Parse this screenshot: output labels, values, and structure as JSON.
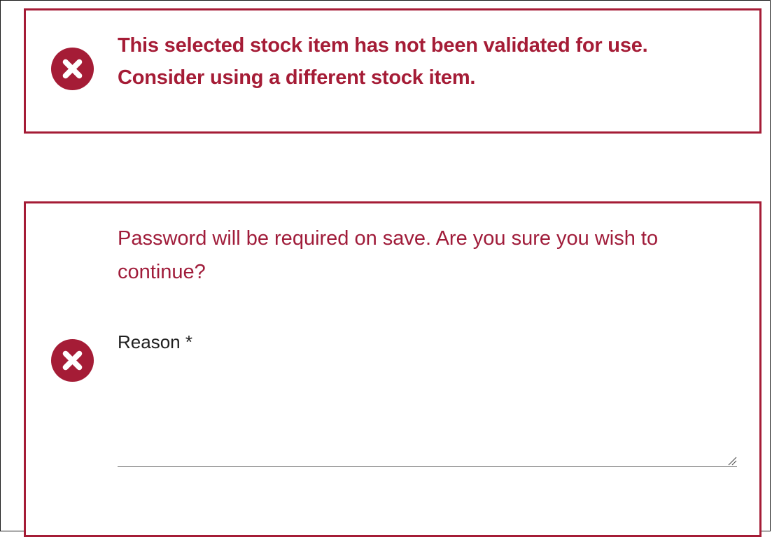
{
  "colors": {
    "accent": "#a51c36",
    "text_dark": "#1f1f1f"
  },
  "alerts": [
    {
      "icon": "error-circle-x-icon",
      "message_line1": "This selected stock item has not been validated for use.",
      "message_line2": "Consider using a different stock item."
    },
    {
      "icon": "error-circle-x-icon",
      "message": "Password will be required on save. Are you sure you wish to continue?",
      "reason": {
        "label": "Reason *",
        "value": "",
        "placeholder": ""
      }
    }
  ]
}
